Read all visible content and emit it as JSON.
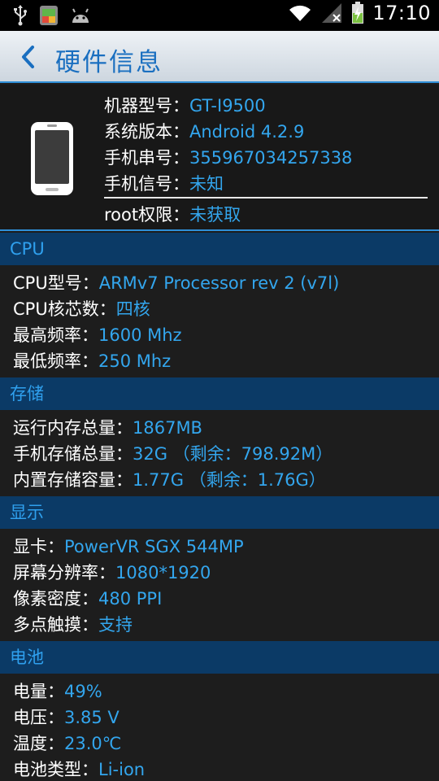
{
  "statusbar": {
    "time": "17:10",
    "icons_left": [
      "usb-icon",
      "app-notification-icon",
      "android-icon"
    ],
    "icons_right": [
      "wifi-icon",
      "signal-icon",
      "battery-charging-icon"
    ]
  },
  "actionbar": {
    "back_label": "❮",
    "title": "硬件信息"
  },
  "device": {
    "rows": [
      {
        "label": "机器型号：",
        "value": "GT-I9500"
      },
      {
        "label": "系统版本：",
        "value": "Android 4.2.9"
      },
      {
        "label": "手机串号：",
        "value": "355967034257338"
      },
      {
        "label": "手机信号：",
        "value": "未知"
      }
    ],
    "root": {
      "label": "root权限：",
      "value": "未获取"
    }
  },
  "sections": {
    "cpu": {
      "title": "CPU",
      "rows": [
        {
          "label": "CPU型号：",
          "value": "ARMv7 Processor rev 2 (v7l)"
        },
        {
          "label": "CPU核芯数：",
          "value": "四核"
        },
        {
          "label": "最高频率：",
          "value": "1600 Mhz"
        },
        {
          "label": "最低频率：",
          "value": "250 Mhz"
        }
      ]
    },
    "storage": {
      "title": "存储",
      "rows": [
        {
          "label": "运行内存总量：",
          "value": "1867MB"
        },
        {
          "label": "手机存储总量：",
          "value": "32G （剩余：798.92M）"
        },
        {
          "label": "内置存储容量：",
          "value": "1.77G （剩余：1.76G）"
        }
      ]
    },
    "display": {
      "title": "显示",
      "rows": [
        {
          "label": "显卡：",
          "value": "PowerVR SGX 544MP"
        },
        {
          "label": "屏幕分辨率：",
          "value": "1080*1920"
        },
        {
          "label": "像素密度：",
          "value": "480 PPI"
        },
        {
          "label": "多点触摸：",
          "value": "支持"
        }
      ]
    },
    "battery": {
      "title": "电池",
      "rows": [
        {
          "label": "电量：",
          "value": "49%"
        },
        {
          "label": "电压：",
          "value": "3.85 V"
        },
        {
          "label": "温度：",
          "value": "23.0℃"
        },
        {
          "label": "电池类型：",
          "value": "Li-ion"
        }
      ]
    }
  },
  "colors": {
    "accent": "#33a6ee",
    "section_bg": "#0b3a66",
    "title": "#1a6fc0"
  }
}
